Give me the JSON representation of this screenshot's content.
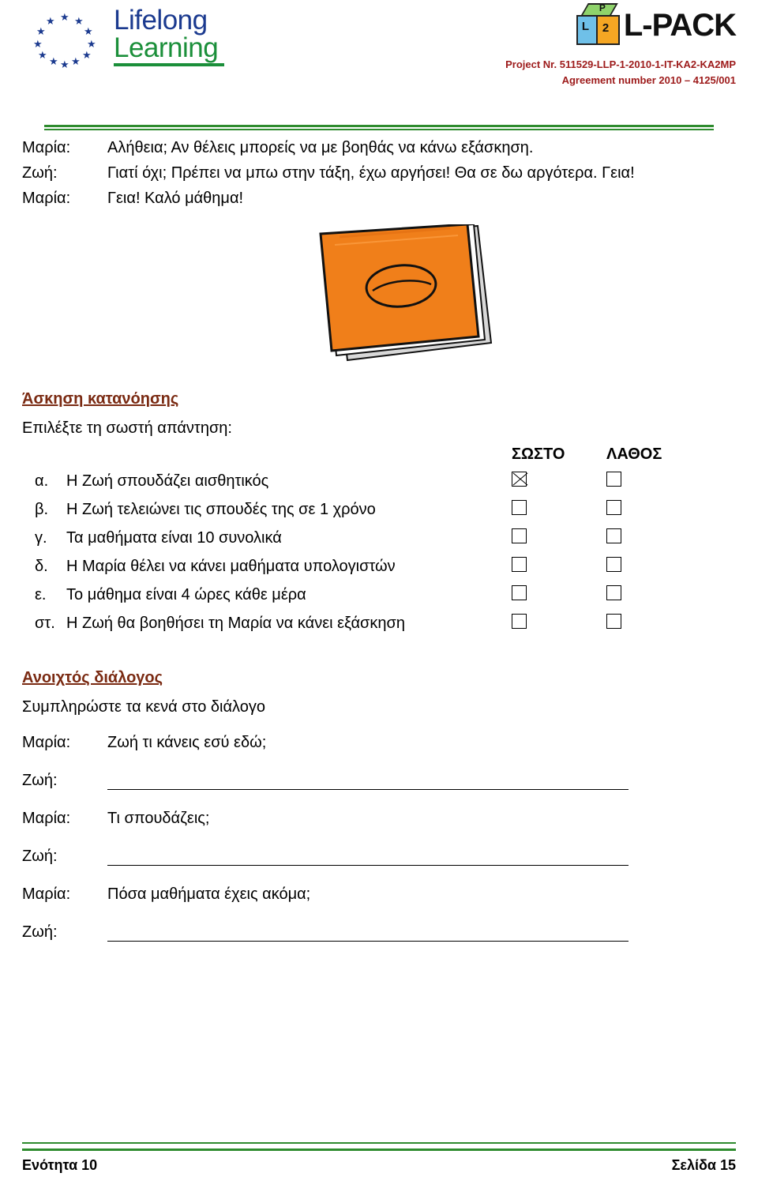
{
  "header": {
    "eu_logo": {
      "line1": "Lifelong",
      "line2": "Learning",
      "alt": "eu-flag-stars"
    },
    "lpack": {
      "brand": "L-PACK",
      "cube_p": "P",
      "cube_l": "L",
      "cube_2": "2"
    },
    "project_number": "Project Nr. 511529-LLP-1-2010-1-IT-KA2-KA2MP",
    "agreement_number": "Agreement number 2010 – 4125/001"
  },
  "dialogue": [
    {
      "speaker": "Μαρία:",
      "text": "Αλήθεια; Αν θέλεις μπορείς να με βοηθάς να κάνω εξάσκηση."
    },
    {
      "speaker": "Ζωή:",
      "text": "Γιατί όχι; Πρέπει να μπω στην τάξη, έχω αργήσει! Θα σε δω αργότερα. Γεια!"
    },
    {
      "speaker": "Μαρία:",
      "text": "Γεια! Καλό μάθημα!"
    }
  ],
  "book_image": "orange-notebook-illustration",
  "comprehension": {
    "heading": "Άσκηση κατανόησης",
    "instruction": "Επιλέξτε τη σωστή απάντηση:",
    "col_true": "ΣΩΣΤΟ",
    "col_false": "ΛΑΘΟΣ",
    "items": [
      {
        "letter": "α.",
        "text": "Η Ζωή σπουδάζει αισθητικός",
        "true_checked": true,
        "false_checked": false
      },
      {
        "letter": "β.",
        "text": "Η Ζωή τελειώνει τις σπουδές της σε 1 χρόνο",
        "true_checked": false,
        "false_checked": false
      },
      {
        "letter": "γ.",
        "text": "Τα μαθήματα είναι 10 συνολικά",
        "true_checked": false,
        "false_checked": false
      },
      {
        "letter": "δ.",
        "text": "Η Μαρία θέλει να κάνει μαθήματα υπολογιστών",
        "true_checked": false,
        "false_checked": false
      },
      {
        "letter": "ε.",
        "text": "Το μάθημα είναι 4 ώρες κάθε μέρα",
        "true_checked": false,
        "false_checked": false
      },
      {
        "letter": "στ.",
        "text": "Η Ζωή θα βοηθήσει τη Μαρία να κάνει εξάσκηση",
        "true_checked": false,
        "false_checked": false
      }
    ]
  },
  "open_dialogue": {
    "heading": "Ανοιχτός διάλογος",
    "instruction": "Συμπληρώστε τα κενά στο διάλογο",
    "rows": [
      {
        "speaker": "Μαρία:",
        "text": "Ζωή τι κάνεις εσύ εδώ;",
        "blank": false
      },
      {
        "speaker": "Ζωή:",
        "text": "",
        "blank": true
      },
      {
        "speaker": "Μαρία:",
        "text": "Τι σπουδάζεις;",
        "blank": false
      },
      {
        "speaker": "Ζωή:",
        "text": "",
        "blank": true
      },
      {
        "speaker": "Μαρία:",
        "text": "Πόσα μαθήματα έχεις ακόμα;",
        "blank": false
      },
      {
        "speaker": "Ζωή:",
        "text": "",
        "blank": true
      }
    ]
  },
  "footer": {
    "left": "Ενότητα 10",
    "right": "Σελίδα 15"
  },
  "colors": {
    "heading": "#7a2a12",
    "rule": "#2e8b2e",
    "project_text": "#9d1a1a",
    "book": "#f07f1a"
  }
}
